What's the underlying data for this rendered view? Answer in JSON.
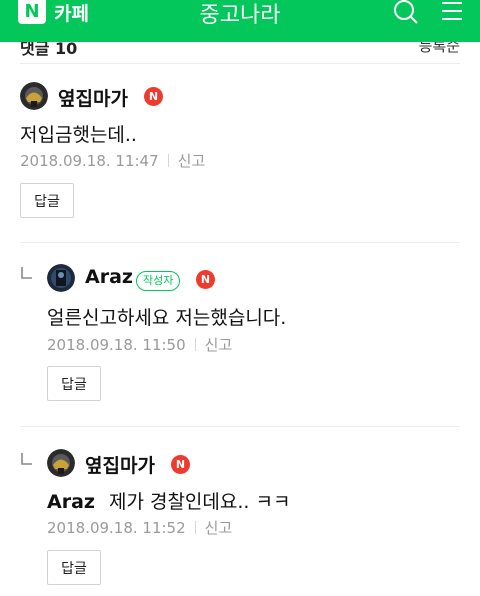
{
  "header": {
    "logo_letter": "N",
    "cafe_label": "카페",
    "title": "중고나라",
    "brand_color": "#03c75a"
  },
  "comments_header": {
    "count_label": "댓글 10",
    "sort_label": "등록순"
  },
  "comments": [
    {
      "nickname": "옆집마가",
      "badge": "N",
      "mention": "",
      "text": "저입금햇는데..",
      "date": "2018.09.18. 11:47",
      "report_label": "신고",
      "reply_label": "답글",
      "is_reply": false,
      "is_author": false
    },
    {
      "nickname": "Araz",
      "author_badge": "작성자",
      "badge": "N",
      "mention": "",
      "text": "얼른신고하세요 저는했습니다.",
      "date": "2018.09.18. 11:50",
      "report_label": "신고",
      "reply_label": "답글",
      "is_reply": true,
      "is_author": true
    },
    {
      "nickname": "옆집마가",
      "badge": "N",
      "mention": "Araz",
      "text": "제가 경찰인데요.. ㅋㅋ",
      "date": "2018.09.18. 11:52",
      "report_label": "신고",
      "reply_label": "답글",
      "is_reply": true,
      "is_author": false
    }
  ],
  "icons": [
    "search-icon",
    "menu-icon",
    "reply-arrow-icon"
  ]
}
